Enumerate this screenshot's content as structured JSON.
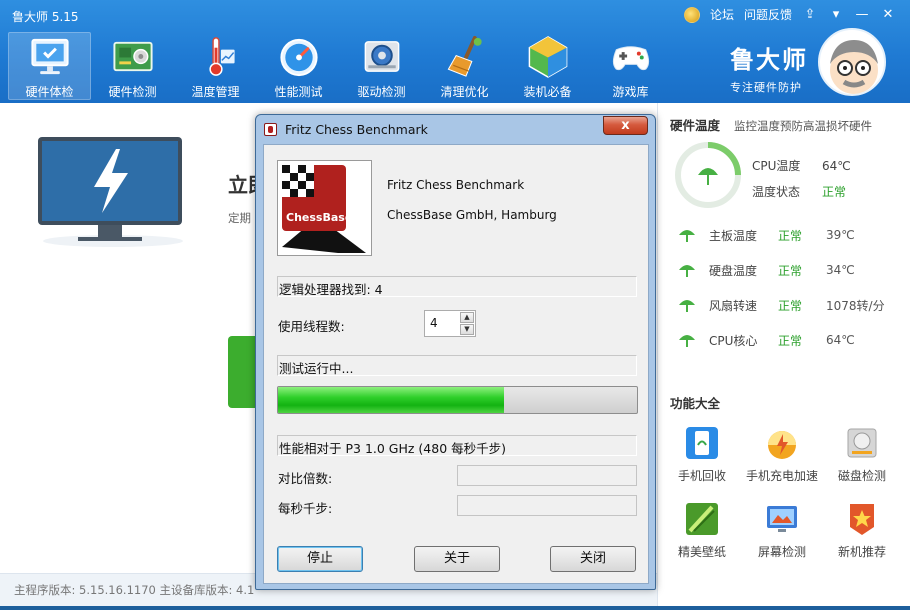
{
  "app": {
    "title": "鲁大师 5.15",
    "top_links": [
      "论坛",
      "问题反馈"
    ],
    "brand_name": "鲁大师",
    "brand_slogan": "专注硬件防护"
  },
  "toolbar": {
    "items": [
      {
        "label": "硬件体检",
        "icon": "monitor-check-icon",
        "active": true
      },
      {
        "label": "硬件检测",
        "icon": "hardware-board-icon"
      },
      {
        "label": "温度管理",
        "icon": "thermometer-icon"
      },
      {
        "label": "性能测试",
        "icon": "speedometer-icon"
      },
      {
        "label": "驱动检测",
        "icon": "gear-driver-icon"
      },
      {
        "label": "清理优化",
        "icon": "broom-icon"
      },
      {
        "label": "装机必备",
        "icon": "cube-icon"
      },
      {
        "label": "游戏库",
        "icon": "gamepad-icon"
      }
    ]
  },
  "main": {
    "scan_title": "立即",
    "scan_sub": "定期"
  },
  "status_bar": {
    "text": "主程序版本: 5.15.16.1170   主设备库版本: 4.1"
  },
  "right_panel": {
    "temp_title": "硬件温度",
    "temp_desc": "监控温度预防高温损坏硬件",
    "cpu_temp_label": "CPU温度",
    "cpu_temp_value": "64℃",
    "temp_state_label": "温度状态",
    "temp_state_value": "正常",
    "rows": [
      {
        "name": "主板温度",
        "status": "正常",
        "value": "39℃"
      },
      {
        "name": "硬盘温度",
        "status": "正常",
        "value": "34℃"
      },
      {
        "name": "风扇转速",
        "status": "正常",
        "value": "1078转/分"
      },
      {
        "name": "CPU核心",
        "status": "正常",
        "value": "64℃"
      }
    ],
    "tools_title": "功能大全",
    "tools": [
      {
        "label": "手机回收",
        "icon": "phone-recycle-icon",
        "color": "#2a8be6"
      },
      {
        "label": "手机充电加速",
        "icon": "charge-boost-icon",
        "color": "#f2a520"
      },
      {
        "label": "磁盘检测",
        "icon": "disk-check-icon",
        "color": "#a6a6a6"
      },
      {
        "label": "精美壁纸",
        "icon": "wallpaper-icon",
        "color": "#4a9a2a"
      },
      {
        "label": "屏幕检测",
        "icon": "screen-test-icon",
        "color": "#3b7bd6"
      },
      {
        "label": "新机推荐",
        "icon": "new-device-icon",
        "color": "#e2572a"
      }
    ]
  },
  "dialog": {
    "title": "Fritz Chess Benchmark",
    "close_symbol": "x",
    "logo_text": "ChessBase",
    "product_name": "Fritz Chess Benchmark",
    "company": "ChessBase GmbH, Hamburg",
    "processors_found": "逻辑处理器找到: 4",
    "threads_label": "使用线程数:",
    "threads_value": "4",
    "running_text": "测试运行中...",
    "progress": 0.63,
    "perf_text": "性能相对于 P3 1.0 GHz (480 每秒千步)",
    "ratio_label": "对比倍数:",
    "knps_label": "每秒千步:",
    "buttons": {
      "stop": "停止",
      "about": "关于",
      "close": "关闭"
    }
  }
}
